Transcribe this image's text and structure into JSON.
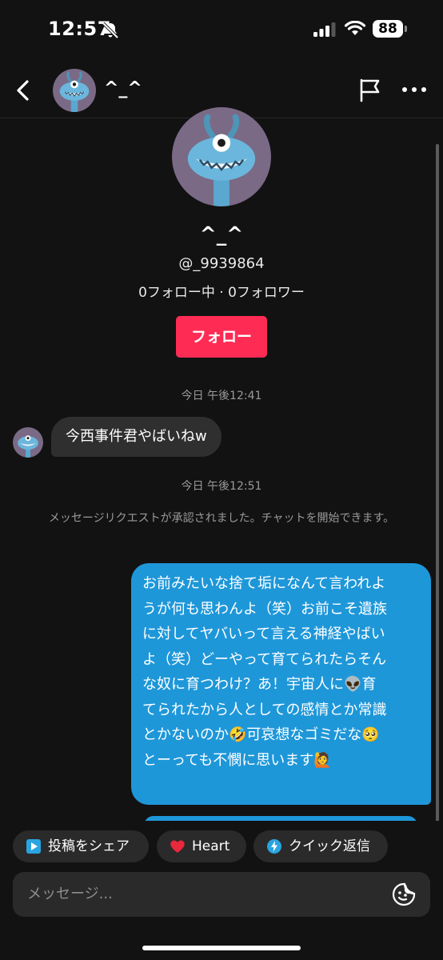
{
  "status_bar": {
    "time": "12:57",
    "battery": "88",
    "icons": [
      "bell-slash-icon",
      "cellular-signal-icon",
      "wifi-icon",
      "battery-icon"
    ]
  },
  "header": {
    "name": "^_^",
    "icons": [
      "chevron-left-icon",
      "flag-icon",
      "more-horizontal-icon"
    ]
  },
  "profile": {
    "name": "^_^",
    "handle": "@_9939864",
    "stats": "0フォロー中 · 0フォロワー",
    "follow_label": "フォロー",
    "accent_color": "#fe2c55"
  },
  "conversation": {
    "timestamp_1": "今日 午後12:41",
    "incoming_message": "今西事件君やばいねw",
    "timestamp_2": "今日 午後12:51",
    "system_note": "メッセージリクエストが承認されました。チャットを開始できます。",
    "outgoing_message_lines": [
      "お前みたいな捨て垢になんて言われよ",
      "うが何も思わんよ（笑）お前こそ遺族",
      "に対してヤバいって言える神経やばい",
      "よ（笑）どーやって育てられたらそん",
      "な奴に育つわけ？あ！宇宙人に👽育",
      "てられたから人としての感情とか常識",
      "とかないのか🤣可哀想なゴミだな🥺",
      "とーっても不憫に思います🙋"
    ],
    "outgoing_color": "#1e97d9"
  },
  "quick_actions": {
    "share_label": "投稿をシェア",
    "heart_label": "Heart",
    "quick_reply_label": "クイック返信"
  },
  "composer": {
    "placeholder": "メッセージ..."
  }
}
